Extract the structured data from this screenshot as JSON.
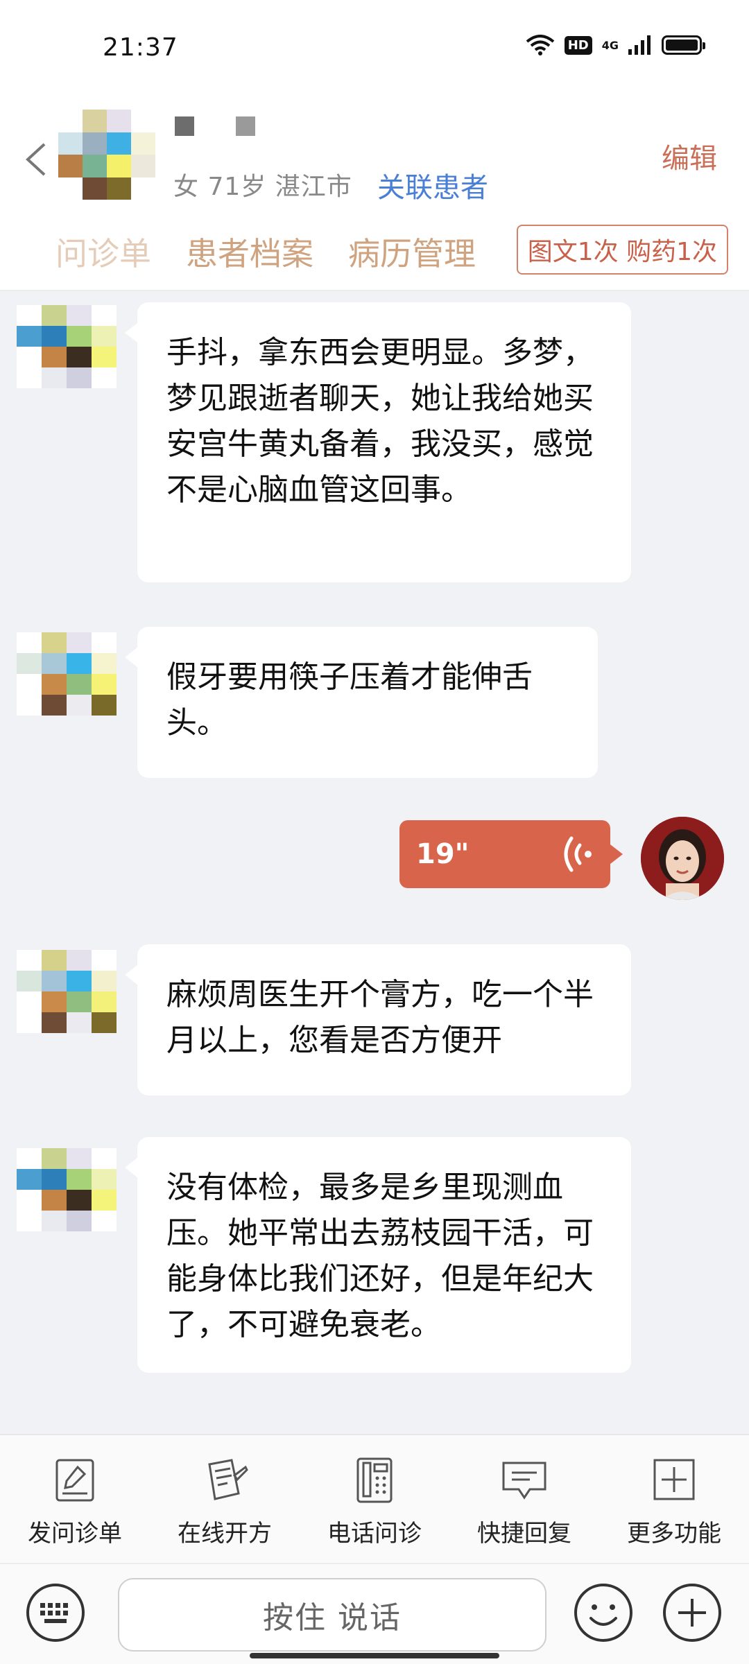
{
  "status_bar": {
    "time": "21:37",
    "hd": "HD",
    "network": "4G"
  },
  "header": {
    "patient_info": "女 71岁  湛江市",
    "link_patient": "关联患者",
    "edit": "编辑",
    "tabs": [
      "问诊单",
      "患者档案",
      "病历管理"
    ],
    "consult_counter": "图文1次 购药1次"
  },
  "messages": [
    {
      "side": "left",
      "text": "手抖，拿东西会更明显。多梦，梦见跟逝者聊天，她让我给她买安宫牛黄丸备着，我没买，感觉不是心脑血管这回事。"
    },
    {
      "side": "left",
      "text": "假牙要用筷子压着才能伸舌头。"
    },
    {
      "side": "right",
      "voice_duration": "19\""
    },
    {
      "side": "left",
      "text": "麻烦周医生开个膏方，吃一个半月以上，您看是否方便开"
    },
    {
      "side": "left",
      "text": "没有体检，最多是乡里现测血压。她平常出去荔枝园干活，可能身体比我们还好，但是年纪大了，不可避免衰老。"
    }
  ],
  "toolbar": [
    {
      "label": "发问诊单",
      "icon": "form-edit-icon"
    },
    {
      "label": "在线开方",
      "icon": "prescription-pen-icon"
    },
    {
      "label": "电话问诊",
      "icon": "phone-icon"
    },
    {
      "label": "快捷回复",
      "icon": "chat-reply-icon"
    },
    {
      "label": "更多功能",
      "icon": "plus-box-icon"
    }
  ],
  "input": {
    "hold_to_talk": "按住 说话"
  }
}
